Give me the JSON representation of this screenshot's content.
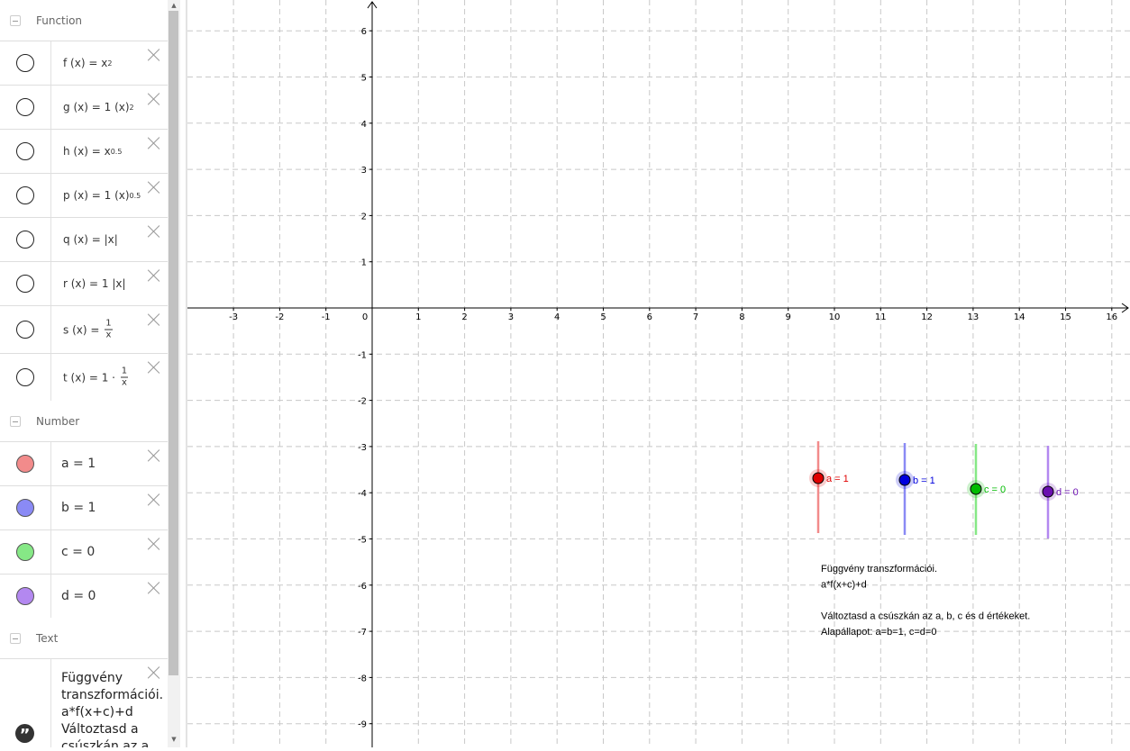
{
  "algebra": {
    "categories": {
      "function": "Function",
      "number": "Number",
      "text": "Text"
    },
    "functions": [
      {
        "name": "f",
        "base": "x",
        "sup": "2",
        "prefix": ""
      },
      {
        "name": "g",
        "base": "(x)",
        "sup": "2",
        "prefix": "1"
      },
      {
        "name": "h",
        "base": "x",
        "sup": "0.5",
        "prefix": ""
      },
      {
        "name": "p",
        "base": "(x)",
        "sup": "0.5",
        "prefix": "1"
      },
      {
        "name": "q",
        "base": "|x|",
        "sup": "",
        "prefix": ""
      },
      {
        "name": "r",
        "base": "|x|",
        "sup": "",
        "prefix": "1"
      },
      {
        "name": "s",
        "frac_num": "1",
        "frac_den": "x",
        "prefix": ""
      },
      {
        "name": "t",
        "frac_num": "1",
        "frac_den": "x",
        "prefix": "1 ·"
      }
    ],
    "numbers": [
      {
        "text": "a = 1",
        "color": "#f28b8b"
      },
      {
        "text": "b = 1",
        "color": "#8a8af5"
      },
      {
        "text": "c = 0",
        "color": "#86e886"
      },
      {
        "text": "d = 0",
        "color": "#b388f0"
      }
    ],
    "text_object": "Függvény\ntranszformációi.\na*f(x+c)+d\nVáltoztasd a\ncsúszkán az a, b, c"
  },
  "graphics": {
    "x_ticks": [
      -3,
      -2,
      -1,
      0,
      1,
      2,
      3,
      4,
      5,
      6,
      7,
      8,
      9,
      10,
      11,
      12,
      13,
      14,
      15,
      16
    ],
    "y_ticks": [
      6,
      5,
      4,
      3,
      2,
      1,
      -1,
      -2,
      -3,
      -4,
      -5,
      -6,
      -7,
      -8,
      -9
    ],
    "sliders": [
      {
        "name": "a",
        "label": "a = 1",
        "color": "#e00000",
        "track": "#f28b8b",
        "value": 1
      },
      {
        "name": "b",
        "label": "b = 1",
        "color": "#0000dd",
        "track": "#8a8af5",
        "value": 1
      },
      {
        "name": "c",
        "label": "c = 0",
        "color": "#00bb00",
        "track": "#86e886",
        "value": 0
      },
      {
        "name": "d",
        "label": "d = 0",
        "color": "#6a0fb0",
        "track": "#b388f0",
        "value": 0
      }
    ],
    "text_lines": [
      "Függvény transzformációi.",
      "a*f(x+c)+d",
      "",
      "Változtasd a csúszkán az a, b, c és d értékeket.",
      "Alapállapot: a=b=1, c=d=0"
    ]
  }
}
